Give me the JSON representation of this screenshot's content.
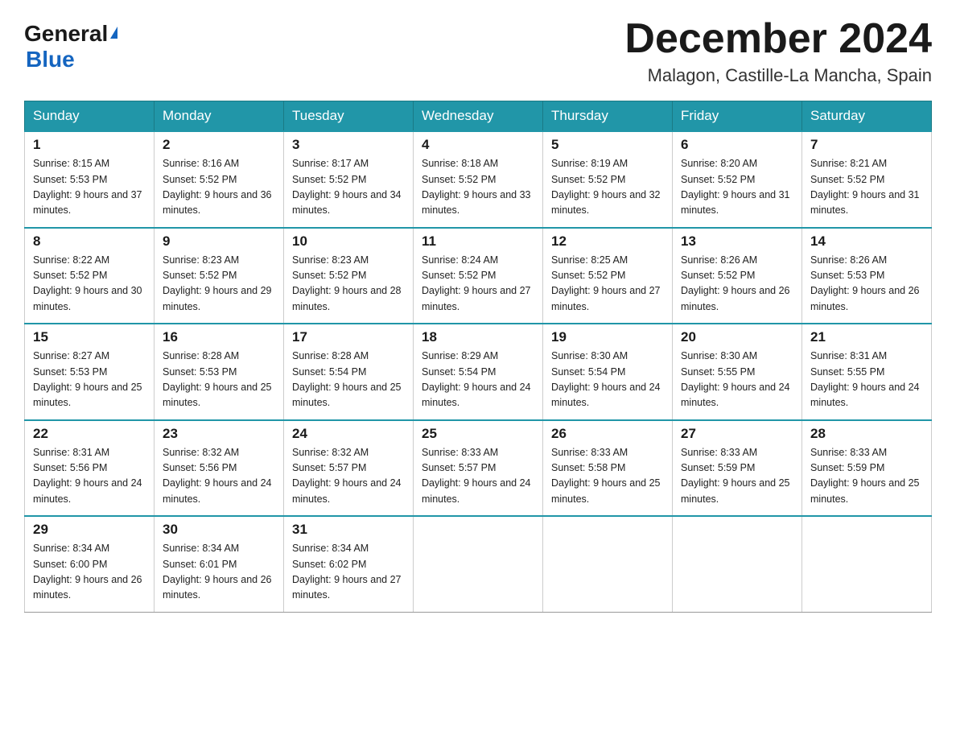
{
  "logo": {
    "line1": "General",
    "line2": "Blue"
  },
  "title": "December 2024",
  "subtitle": "Malagon, Castille-La Mancha, Spain",
  "days_of_week": [
    "Sunday",
    "Monday",
    "Tuesday",
    "Wednesday",
    "Thursday",
    "Friday",
    "Saturday"
  ],
  "weeks": [
    [
      {
        "day": "1",
        "sunrise": "8:15 AM",
        "sunset": "5:53 PM",
        "daylight": "9 hours and 37 minutes."
      },
      {
        "day": "2",
        "sunrise": "8:16 AM",
        "sunset": "5:52 PM",
        "daylight": "9 hours and 36 minutes."
      },
      {
        "day": "3",
        "sunrise": "8:17 AM",
        "sunset": "5:52 PM",
        "daylight": "9 hours and 34 minutes."
      },
      {
        "day": "4",
        "sunrise": "8:18 AM",
        "sunset": "5:52 PM",
        "daylight": "9 hours and 33 minutes."
      },
      {
        "day": "5",
        "sunrise": "8:19 AM",
        "sunset": "5:52 PM",
        "daylight": "9 hours and 32 minutes."
      },
      {
        "day": "6",
        "sunrise": "8:20 AM",
        "sunset": "5:52 PM",
        "daylight": "9 hours and 31 minutes."
      },
      {
        "day": "7",
        "sunrise": "8:21 AM",
        "sunset": "5:52 PM",
        "daylight": "9 hours and 31 minutes."
      }
    ],
    [
      {
        "day": "8",
        "sunrise": "8:22 AM",
        "sunset": "5:52 PM",
        "daylight": "9 hours and 30 minutes."
      },
      {
        "day": "9",
        "sunrise": "8:23 AM",
        "sunset": "5:52 PM",
        "daylight": "9 hours and 29 minutes."
      },
      {
        "day": "10",
        "sunrise": "8:23 AM",
        "sunset": "5:52 PM",
        "daylight": "9 hours and 28 minutes."
      },
      {
        "day": "11",
        "sunrise": "8:24 AM",
        "sunset": "5:52 PM",
        "daylight": "9 hours and 27 minutes."
      },
      {
        "day": "12",
        "sunrise": "8:25 AM",
        "sunset": "5:52 PM",
        "daylight": "9 hours and 27 minutes."
      },
      {
        "day": "13",
        "sunrise": "8:26 AM",
        "sunset": "5:52 PM",
        "daylight": "9 hours and 26 minutes."
      },
      {
        "day": "14",
        "sunrise": "8:26 AM",
        "sunset": "5:53 PM",
        "daylight": "9 hours and 26 minutes."
      }
    ],
    [
      {
        "day": "15",
        "sunrise": "8:27 AM",
        "sunset": "5:53 PM",
        "daylight": "9 hours and 25 minutes."
      },
      {
        "day": "16",
        "sunrise": "8:28 AM",
        "sunset": "5:53 PM",
        "daylight": "9 hours and 25 minutes."
      },
      {
        "day": "17",
        "sunrise": "8:28 AM",
        "sunset": "5:54 PM",
        "daylight": "9 hours and 25 minutes."
      },
      {
        "day": "18",
        "sunrise": "8:29 AM",
        "sunset": "5:54 PM",
        "daylight": "9 hours and 24 minutes."
      },
      {
        "day": "19",
        "sunrise": "8:30 AM",
        "sunset": "5:54 PM",
        "daylight": "9 hours and 24 minutes."
      },
      {
        "day": "20",
        "sunrise": "8:30 AM",
        "sunset": "5:55 PM",
        "daylight": "9 hours and 24 minutes."
      },
      {
        "day": "21",
        "sunrise": "8:31 AM",
        "sunset": "5:55 PM",
        "daylight": "9 hours and 24 minutes."
      }
    ],
    [
      {
        "day": "22",
        "sunrise": "8:31 AM",
        "sunset": "5:56 PM",
        "daylight": "9 hours and 24 minutes."
      },
      {
        "day": "23",
        "sunrise": "8:32 AM",
        "sunset": "5:56 PM",
        "daylight": "9 hours and 24 minutes."
      },
      {
        "day": "24",
        "sunrise": "8:32 AM",
        "sunset": "5:57 PM",
        "daylight": "9 hours and 24 minutes."
      },
      {
        "day": "25",
        "sunrise": "8:33 AM",
        "sunset": "5:57 PM",
        "daylight": "9 hours and 24 minutes."
      },
      {
        "day": "26",
        "sunrise": "8:33 AM",
        "sunset": "5:58 PM",
        "daylight": "9 hours and 25 minutes."
      },
      {
        "day": "27",
        "sunrise": "8:33 AM",
        "sunset": "5:59 PM",
        "daylight": "9 hours and 25 minutes."
      },
      {
        "day": "28",
        "sunrise": "8:33 AM",
        "sunset": "5:59 PM",
        "daylight": "9 hours and 25 minutes."
      }
    ],
    [
      {
        "day": "29",
        "sunrise": "8:34 AM",
        "sunset": "6:00 PM",
        "daylight": "9 hours and 26 minutes."
      },
      {
        "day": "30",
        "sunrise": "8:34 AM",
        "sunset": "6:01 PM",
        "daylight": "9 hours and 26 minutes."
      },
      {
        "day": "31",
        "sunrise": "8:34 AM",
        "sunset": "6:02 PM",
        "daylight": "9 hours and 27 minutes."
      },
      null,
      null,
      null,
      null
    ]
  ]
}
